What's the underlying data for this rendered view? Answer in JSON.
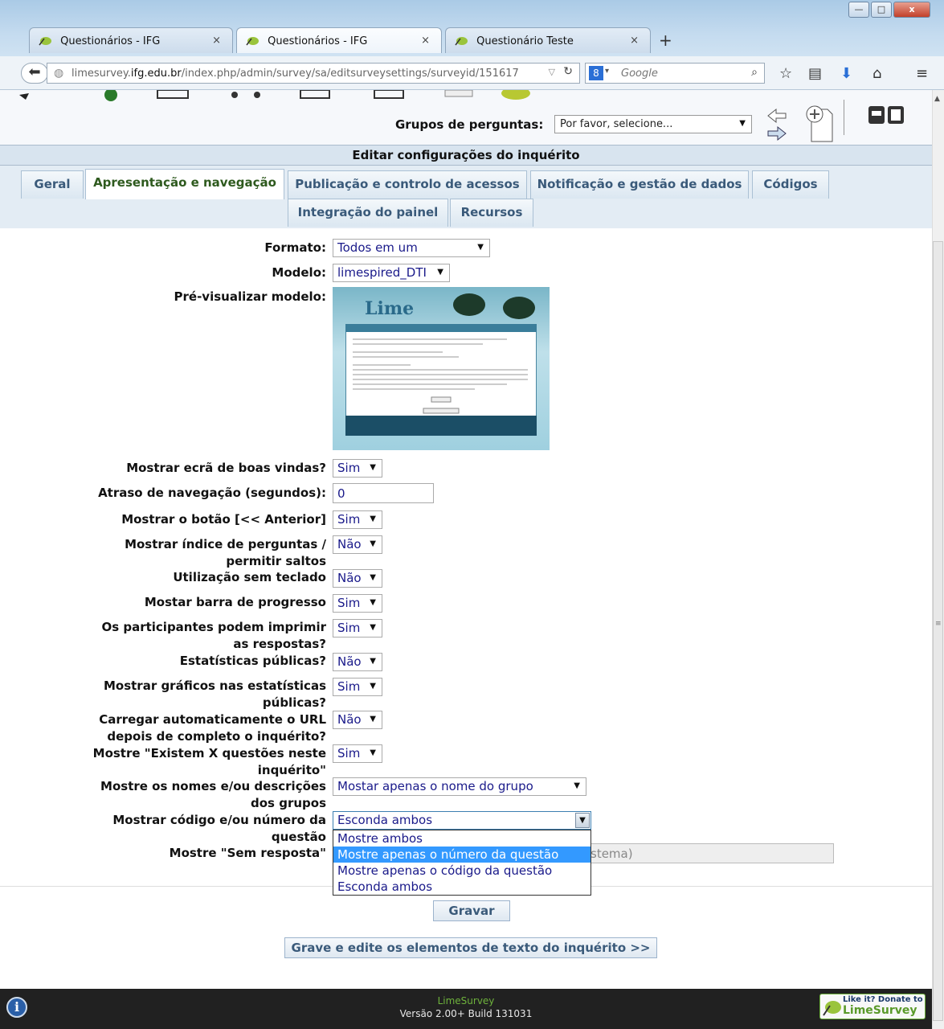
{
  "browser": {
    "tabs": [
      {
        "title": "Questionários - IFG",
        "close": "×"
      },
      {
        "title": "Questionários - IFG",
        "close": "×"
      },
      {
        "title": "Questionário Teste",
        "close": "×"
      }
    ],
    "new_tab": "+",
    "url_prefix": "limesurvey.",
    "url_host": "ifg.edu.br",
    "url_path": "/index.php/admin/survey/sa/editsurveysettings/surveyid/151617",
    "search_engine": "8",
    "search_placeholder": "Google"
  },
  "toolbar": {
    "groups_label": "Grupos de perguntas:",
    "groups_value": "Por favor, selecione..."
  },
  "page_title": "Editar configurações do inquérito",
  "tabs": [
    "Geral",
    "Apresentação e navegação",
    "Publicação e controlo de acessos",
    "Notificação e gestão de dados",
    "Códigos",
    "Integração do painel",
    "Recursos"
  ],
  "form": {
    "formato": {
      "label": "Formato:",
      "value": "Todos em um"
    },
    "modelo": {
      "label": "Modelo:",
      "value": "limespired_DTI"
    },
    "preview_label": "Pré-visualizar modelo:",
    "preview_logo": "Lime",
    "welcome": {
      "label": "Mostrar ecrã de boas vindas?",
      "value": "Sim"
    },
    "delay": {
      "label": "Atraso de navegação (segundos):",
      "value": "0"
    },
    "prev_btn": {
      "label": "Mostrar o botão [<< Anterior]",
      "value": "Sim"
    },
    "index": {
      "label_1": "Mostrar índice de perguntas /",
      "label_2": "permitir saltos",
      "value": "Não"
    },
    "keyboard": {
      "label": "Utilização sem teclado",
      "value": "Não"
    },
    "progress": {
      "label": "Mostar barra de progresso",
      "value": "Sim"
    },
    "print": {
      "label_1": "Os participantes podem imprimir",
      "label_2": "as respostas?",
      "value": "Sim"
    },
    "stats": {
      "label": "Estatísticas públicas?",
      "value": "Não"
    },
    "charts": {
      "label_1": "Mostrar gráficos nas estatísticas",
      "label_2": "públicas?",
      "value": "Sim"
    },
    "autourl": {
      "label_1": "Carregar automaticamente o URL",
      "label_2": "depois de completo o inquérito?",
      "value": "Não"
    },
    "xquestions": {
      "label_1": "Mostre \"Existem X questões neste",
      "label_2": "inquérito\"",
      "value": "Sim"
    },
    "groupnames": {
      "label_1": "Mostre os nomes e/ou descrições",
      "label_2": "dos grupos",
      "value": "Mostar apenas o nome do grupo"
    },
    "qcode": {
      "label_1": "Mostrar código e/ou número da",
      "label_2": "questão",
      "value": "Esconda ambos"
    },
    "noanswer": {
      "label": "Mostre \"Sem resposta\"",
      "value": "stema)"
    }
  },
  "dropdown_options": [
    "Mostre ambos",
    "Mostre apenas o número da questão",
    "Mostre apenas o código da questão",
    "Esconda ambos"
  ],
  "buttons": {
    "save": "Gravar",
    "save_edit": "Grave e edite os elementos de texto do inquérito >>"
  },
  "footer": {
    "app": "LimeSurvey",
    "version": "Versão 2.00+ Build 131031",
    "donate_small": "Like it? Donate to",
    "donate_logo": "LimeSurvey"
  }
}
